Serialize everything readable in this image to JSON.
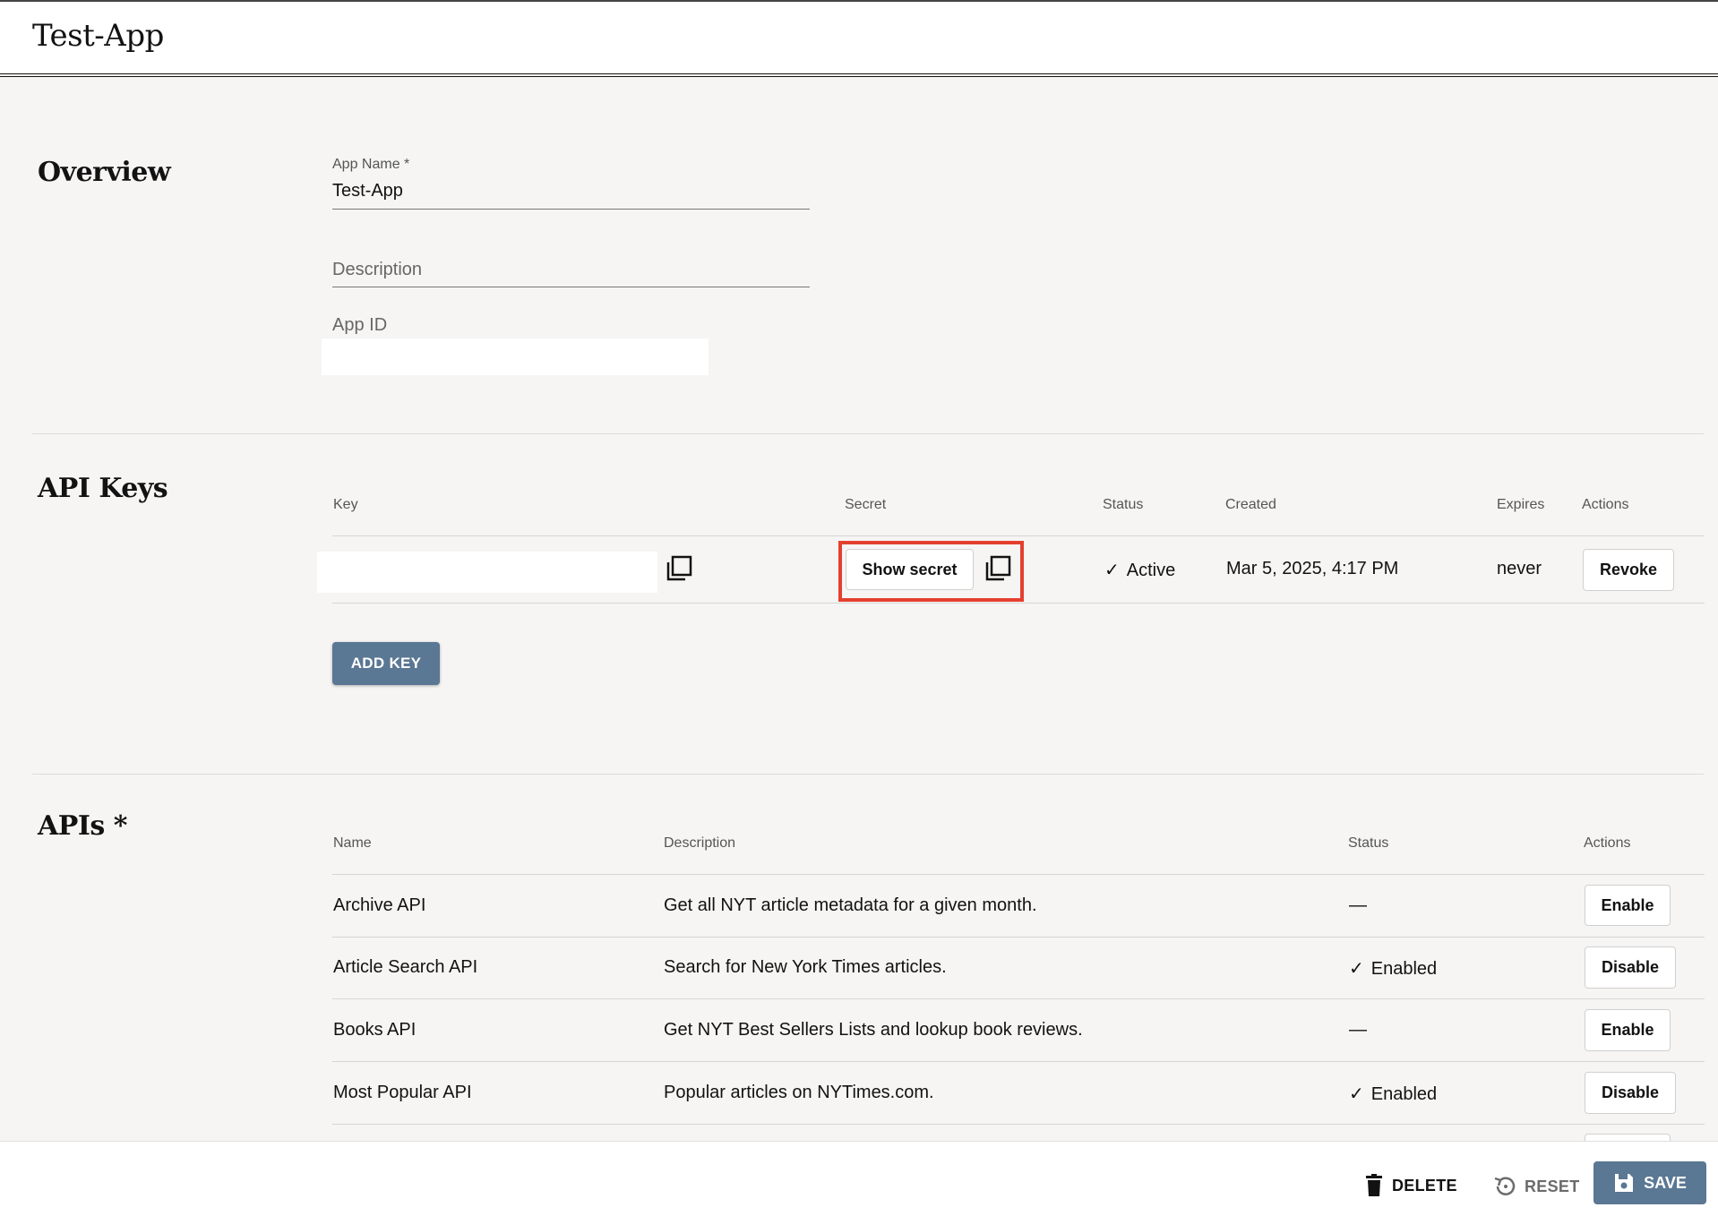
{
  "header": {
    "title": "Test-App"
  },
  "overview": {
    "section_title": "Overview",
    "app_name_label": "App Name *",
    "app_name_value": "Test-App",
    "description_placeholder": "Description",
    "app_id_label": "App ID"
  },
  "api_keys": {
    "section_title": "API Keys",
    "columns": {
      "key": "Key",
      "secret": "Secret",
      "status": "Status",
      "created": "Created",
      "expires": "Expires",
      "actions": "Actions"
    },
    "rows": [
      {
        "show_secret_label": "Show secret",
        "status": "Active",
        "created": "Mar 5, 2025, 4:17 PM",
        "expires": "never",
        "action_label": "Revoke"
      }
    ],
    "add_key_label": "ADD KEY"
  },
  "apis": {
    "section_title": "APIs *",
    "columns": {
      "name": "Name",
      "description": "Description",
      "status": "Status",
      "actions": "Actions"
    },
    "rows": [
      {
        "name": "Archive API",
        "description": "Get all NYT article metadata for a given month.",
        "status": "—",
        "action": "Enable"
      },
      {
        "name": "Article Search API",
        "description": "Search for New York Times articles.",
        "status": "Enabled",
        "action": "Disable"
      },
      {
        "name": "Books API",
        "description": "Get NYT Best Sellers Lists and lookup book reviews.",
        "status": "—",
        "action": "Enable"
      },
      {
        "name": "Most Popular API",
        "description": "Popular articles on NYTimes.com.",
        "status": "Enabled",
        "action": "Disable"
      }
    ]
  },
  "footer": {
    "delete_label": "DELETE",
    "reset_label": "RESET",
    "save_label": "SAVE"
  },
  "colors": {
    "accent": "#5a7793",
    "highlight": "#e4402f",
    "background": "#f6f5f4"
  }
}
